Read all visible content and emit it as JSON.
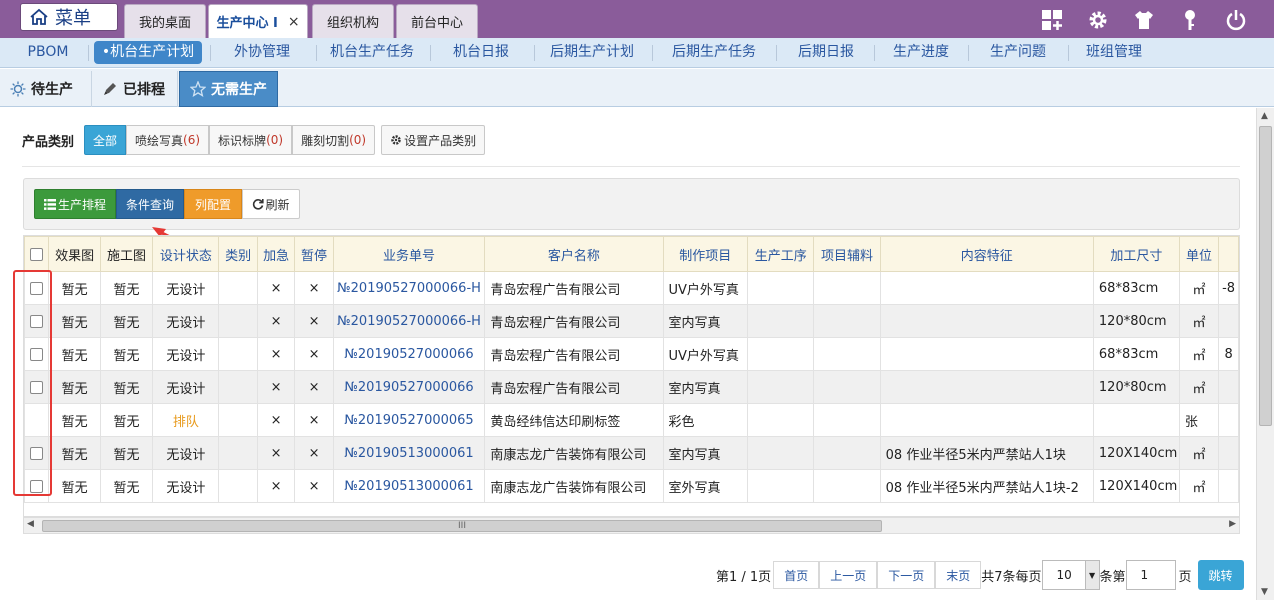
{
  "menu_label": "菜单",
  "tabs": [
    {
      "label": "我的桌面",
      "closable": false
    },
    {
      "label": "生产中心 I",
      "closable": true,
      "close": "×"
    },
    {
      "label": "组织机构",
      "closable": false
    },
    {
      "label": "前台中心",
      "closable": false
    }
  ],
  "subnav": [
    "PBOM",
    "•机台生产计划",
    "外协管理",
    "机台生产任务",
    "机台日报",
    "后期生产计划",
    "后期生产任务",
    "后期日报",
    "生产进度",
    "生产问题",
    "班组管理"
  ],
  "status_tabs": [
    "待生产",
    "已排程",
    "无需生产"
  ],
  "category": {
    "label": "产品类别",
    "items": [
      {
        "label": "全部",
        "count": ""
      },
      {
        "label": "喷绘写真",
        "count": "(6)"
      },
      {
        "label": "标识标牌",
        "count": "(0)"
      },
      {
        "label": "雕刻切割",
        "count": "(0)"
      }
    ],
    "set_label": "设置产品类别"
  },
  "toolbar": {
    "schedule": "生产排程",
    "query": "条件查询",
    "columns": "列配置",
    "refresh": "刷新"
  },
  "colors": {
    "green": "#3c9a3c",
    "blue": "#2f6aa3",
    "orange": "#ef9b2a",
    "accent": "#3aa5d6",
    "purple": "#8a5c9a"
  },
  "table": {
    "headers": [
      "效果图",
      "施工图",
      "设计状态",
      "类别",
      "加急",
      "暂停",
      "业务单号",
      "客户名称",
      "制作项目",
      "生产工序",
      "项目辅料",
      "内容特征",
      "加工尺寸",
      "单位",
      ""
    ],
    "rows": [
      {
        "chk": true,
        "c": [
          "暂无",
          "暂无",
          "无设计",
          "",
          "×",
          "×",
          "№20190527000066-H",
          "青岛宏程广告有限公司",
          "UV户外写真",
          "",
          "",
          "",
          "68*83cm",
          "㎡",
          "-8"
        ]
      },
      {
        "chk": true,
        "c": [
          "暂无",
          "暂无",
          "无设计",
          "",
          "×",
          "×",
          "№20190527000066-H",
          "青岛宏程广告有限公司",
          "室内写真",
          "",
          "",
          "",
          "120*80cm",
          "㎡",
          ""
        ]
      },
      {
        "chk": true,
        "c": [
          "暂无",
          "暂无",
          "无设计",
          "",
          "×",
          "×",
          "№20190527000066",
          "青岛宏程广告有限公司",
          "UV户外写真",
          "",
          "",
          "",
          "68*83cm",
          "㎡",
          "8"
        ]
      },
      {
        "chk": true,
        "c": [
          "暂无",
          "暂无",
          "无设计",
          "",
          "×",
          "×",
          "№20190527000066",
          "青岛宏程广告有限公司",
          "室内写真",
          "",
          "",
          "",
          "120*80cm",
          "㎡",
          ""
        ]
      },
      {
        "chk": false,
        "c": [
          "暂无",
          "暂无",
          "排队",
          "",
          "×",
          "×",
          "№20190527000065",
          "黄岛经纬信达印刷标签",
          "彩色",
          "",
          "",
          "",
          "",
          "张",
          ""
        ]
      },
      {
        "chk": true,
        "c": [
          "暂无",
          "暂无",
          "无设计",
          "",
          "×",
          "×",
          "№20190513000061",
          "南康志龙广告装饰有限公司",
          "室内写真",
          "",
          "",
          "08 作业半径5米内严禁站人1块",
          "120X140cm",
          "㎡",
          ""
        ]
      },
      {
        "chk": true,
        "c": [
          "暂无",
          "暂无",
          "无设计",
          "",
          "×",
          "×",
          "№20190513000061",
          "南康志龙广告装饰有限公司",
          "室外写真",
          "",
          "",
          "08 作业半径5米内严禁站人1块-2",
          "120X140cm",
          "㎡",
          ""
        ]
      }
    ]
  },
  "scroll_thumb": "III",
  "pager": {
    "page_info": "第1 / 1页",
    "first": "首页",
    "prev": "上一页",
    "next": "下一页",
    "last": "末页",
    "total": "共7条每页",
    "page_size": "10",
    "goto_prefix": "条第",
    "goto_value": "1",
    "goto_suffix": "页",
    "jump": "跳转"
  }
}
